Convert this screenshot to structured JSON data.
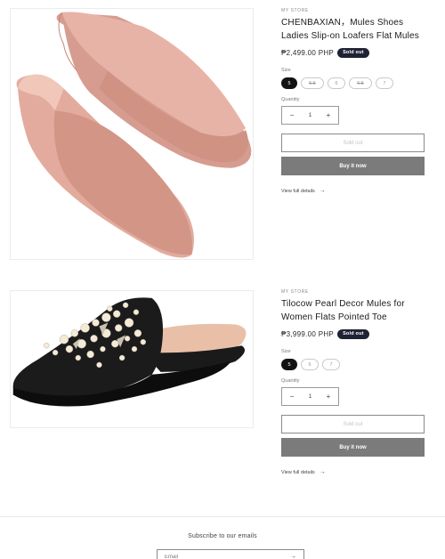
{
  "products": [
    {
      "vendor": "My Store",
      "title": "CHENBAXIAN，Mules Shoes Ladies Slip-on Loafers Flat Mules",
      "price": "₱2,499.00 PHP",
      "badge": "Sold out",
      "size_label": "Size",
      "sizes": [
        "5",
        "5.5",
        "6",
        "6.5",
        "7"
      ],
      "quantity_label": "Quantity",
      "quantity": "1",
      "sold_out_button": "Sold out",
      "buy_now_button": "Buy it now",
      "view_details": "View full details",
      "image_icon": "pink-suede-mules-image"
    },
    {
      "vendor": "My Store",
      "title": "Tilocow Pearl Decor Mules for Women Flats Pointed Toe",
      "price": "₱3,999.00 PHP",
      "badge": "Sold out",
      "size_label": "Size",
      "sizes": [
        "5",
        "6",
        "7"
      ],
      "quantity_label": "Quantity",
      "quantity": "1",
      "sold_out_button": "Sold out",
      "buy_now_button": "Buy it now",
      "view_details": "View full details",
      "image_icon": "black-pearl-mule-image"
    }
  ],
  "footer": {
    "subscribe_title": "Subscribe to our emails",
    "email_placeholder": "Email"
  },
  "colors": {
    "badge": "#1e2235",
    "buy_button": "#7b7b7b",
    "suede_pink": "#dba397",
    "black_shoe": "#1a1a1a"
  }
}
